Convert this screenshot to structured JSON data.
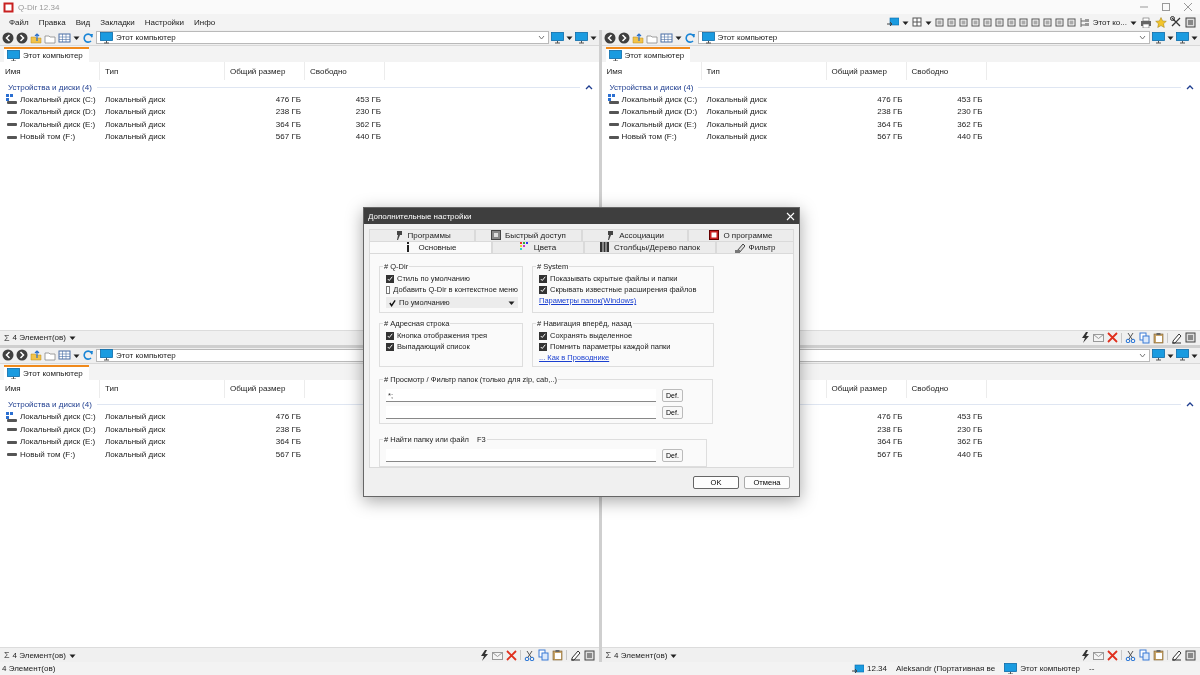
{
  "window": {
    "title": "Q-Dir 12.34"
  },
  "menu": [
    "Файл",
    "Правка",
    "Вид",
    "Закладки",
    "Настройки",
    "Инфо"
  ],
  "toolbar": {
    "view_label": "Этот ко..."
  },
  "panes": [
    {
      "address": "Этот компьютер",
      "tab": {
        "label": "Этот компьютер",
        "selected": true
      },
      "columns": {
        "name": "Имя",
        "type": "Тип",
        "size": "Общий размер",
        "free": "Свободно"
      },
      "group": "Устройства и диски (4)",
      "rows": [
        {
          "kind": "system",
          "name": "Локальный диск (C:)",
          "type": "Локальный диск",
          "size": "476 ГБ",
          "free": "453 ГБ"
        },
        {
          "kind": "drive",
          "name": "Локальный диск (D:)",
          "type": "Локальный диск",
          "size": "238 ГБ",
          "free": "230 ГБ"
        },
        {
          "kind": "drive",
          "name": "Локальный диск (E:)",
          "type": "Локальный диск",
          "size": "364 ГБ",
          "free": "362 ГБ"
        },
        {
          "kind": "drive",
          "name": "Новый том (F:)",
          "type": "Локальный диск",
          "size": "567 ГБ",
          "free": "440 ГБ"
        }
      ],
      "status_icon": "Σ",
      "status": "4 Элемент(ов)"
    },
    {
      "address": "Этот компьютер",
      "tab": {
        "label": "Этот компьютер",
        "selected": true
      },
      "columns": {
        "name": "Имя",
        "type": "Тип",
        "size": "Общий размер",
        "free": "Свободно"
      },
      "group": "Устройства и диски (4)",
      "rows": [
        {
          "kind": "system",
          "name": "Локальный диск (C:)",
          "type": "Локальный диск",
          "size": "476 ГБ",
          "free": "453 ГБ"
        },
        {
          "kind": "drive",
          "name": "Локальный диск (D:)",
          "type": "Локальный диск",
          "size": "238 ГБ",
          "free": "230 ГБ"
        },
        {
          "kind": "drive",
          "name": "Локальный диск (E:)",
          "type": "Локальный диск",
          "size": "364 ГБ",
          "free": "362 ГБ"
        },
        {
          "kind": "drive",
          "name": "Новый том (F:)",
          "type": "Локальный диск",
          "size": "567 ГБ",
          "free": "440 ГБ"
        }
      ]
    },
    {
      "address": "Этот компьютер",
      "tab": {
        "label": "Этот компьютер",
        "selected": true
      },
      "columns": {
        "name": "Имя",
        "type": "Тип",
        "size": "Общий размер"
      },
      "group": "Устройства и диски (4)",
      "rows": [
        {
          "kind": "system",
          "name": "Локальный диск (C:)",
          "type": "Локальный диск",
          "size": "476 ГБ"
        },
        {
          "kind": "drive",
          "name": "Локальный диск (D:)",
          "type": "Локальный диск",
          "size": "238 ГБ"
        },
        {
          "kind": "drive",
          "name": "Локальный диск (E:)",
          "type": "Локальный диск",
          "size": "364 ГБ"
        },
        {
          "kind": "drive",
          "name": "Новый том (F:)",
          "type": "Локальный диск",
          "size": "567 ГБ"
        }
      ],
      "status_icon": "Σ",
      "status": "4 Элемент(ов)"
    },
    {
      "columns": {
        "size": "Общий размер",
        "free": "Свободно"
      },
      "rows": [
        {
          "size": "476 ГБ",
          "free": "453 ГБ"
        },
        {
          "size": "238 ГБ",
          "free": "230 ГБ"
        },
        {
          "size": "364 ГБ",
          "free": "362 ГБ"
        },
        {
          "size": "567 ГБ",
          "free": "440 ГБ"
        }
      ],
      "status_icon": "Σ",
      "status": "4 Элемент(ов)"
    }
  ],
  "dialog": {
    "title": "Дополнительные настройки",
    "tab_rows": [
      [
        {
          "label": "Программы",
          "selected": false
        },
        {
          "label": "Быстрый доступ",
          "selected": false
        },
        {
          "label": "Ассоциации",
          "selected": false
        },
        {
          "label": "О программе",
          "selected": false
        }
      ],
      [
        {
          "label": "Основные",
          "selected": true
        },
        {
          "label": "Цвета",
          "selected": false
        },
        {
          "label": "Столбцы/Дерево папок",
          "selected": false
        },
        {
          "label": "Фильтр",
          "selected": false
        }
      ]
    ],
    "groups": [
      {
        "title": "# Q-Dir",
        "items": [
          {
            "kind": "checkbox",
            "label": "Стиль по умолчанию",
            "checked": true
          },
          {
            "kind": "checkbox",
            "label": "Добавить Q-Dir в контекстное меню",
            "checked": false
          },
          {
            "kind": "dropdown",
            "value": "По умолчанию"
          }
        ]
      },
      {
        "title": "# System",
        "items": [
          {
            "kind": "checkbox",
            "label": "Показывать скрытые файлы и папки",
            "checked": true
          },
          {
            "kind": "checkbox",
            "label": "Скрывать известные расширения файлов",
            "checked": true
          },
          {
            "kind": "link",
            "label": "Параметры папок(Windows)"
          }
        ]
      },
      {
        "title": "# Адресная строка",
        "items": [
          {
            "kind": "checkbox",
            "label": "Кнопка отображения трея",
            "checked": true
          },
          {
            "kind": "checkbox",
            "label": "Выпадающий список",
            "checked": true
          }
        ]
      },
      {
        "title": "# Навигация вперёд, назад",
        "items": [
          {
            "kind": "checkbox",
            "label": "Сохранять выделенное",
            "checked": true
          },
          {
            "kind": "checkbox",
            "label": "Помнить параметры каждой папки",
            "checked": true
          },
          {
            "kind": "link",
            "label": "... Как в Проводнике"
          }
        ]
      }
    ],
    "field_groups": [
      {
        "title": "# Просмотр / Фильтр папок (только для zip, cab,..)",
        "fields": [
          {
            "value": "*;",
            "button": "Def."
          },
          {
            "button": "Def."
          }
        ]
      },
      {
        "title": "# Найти папку или файл",
        "hotkey": "F3",
        "fields": [
          {
            "button": "Def."
          }
        ]
      }
    ],
    "buttons": [
      "OK",
      "Отмена"
    ]
  },
  "status_bar": {
    "items": "4 Элемент(ов)",
    "version": "12.34",
    "user": "Aleksandr (Портативная ве",
    "location": "Этот компьютер",
    "extra": "--"
  }
}
